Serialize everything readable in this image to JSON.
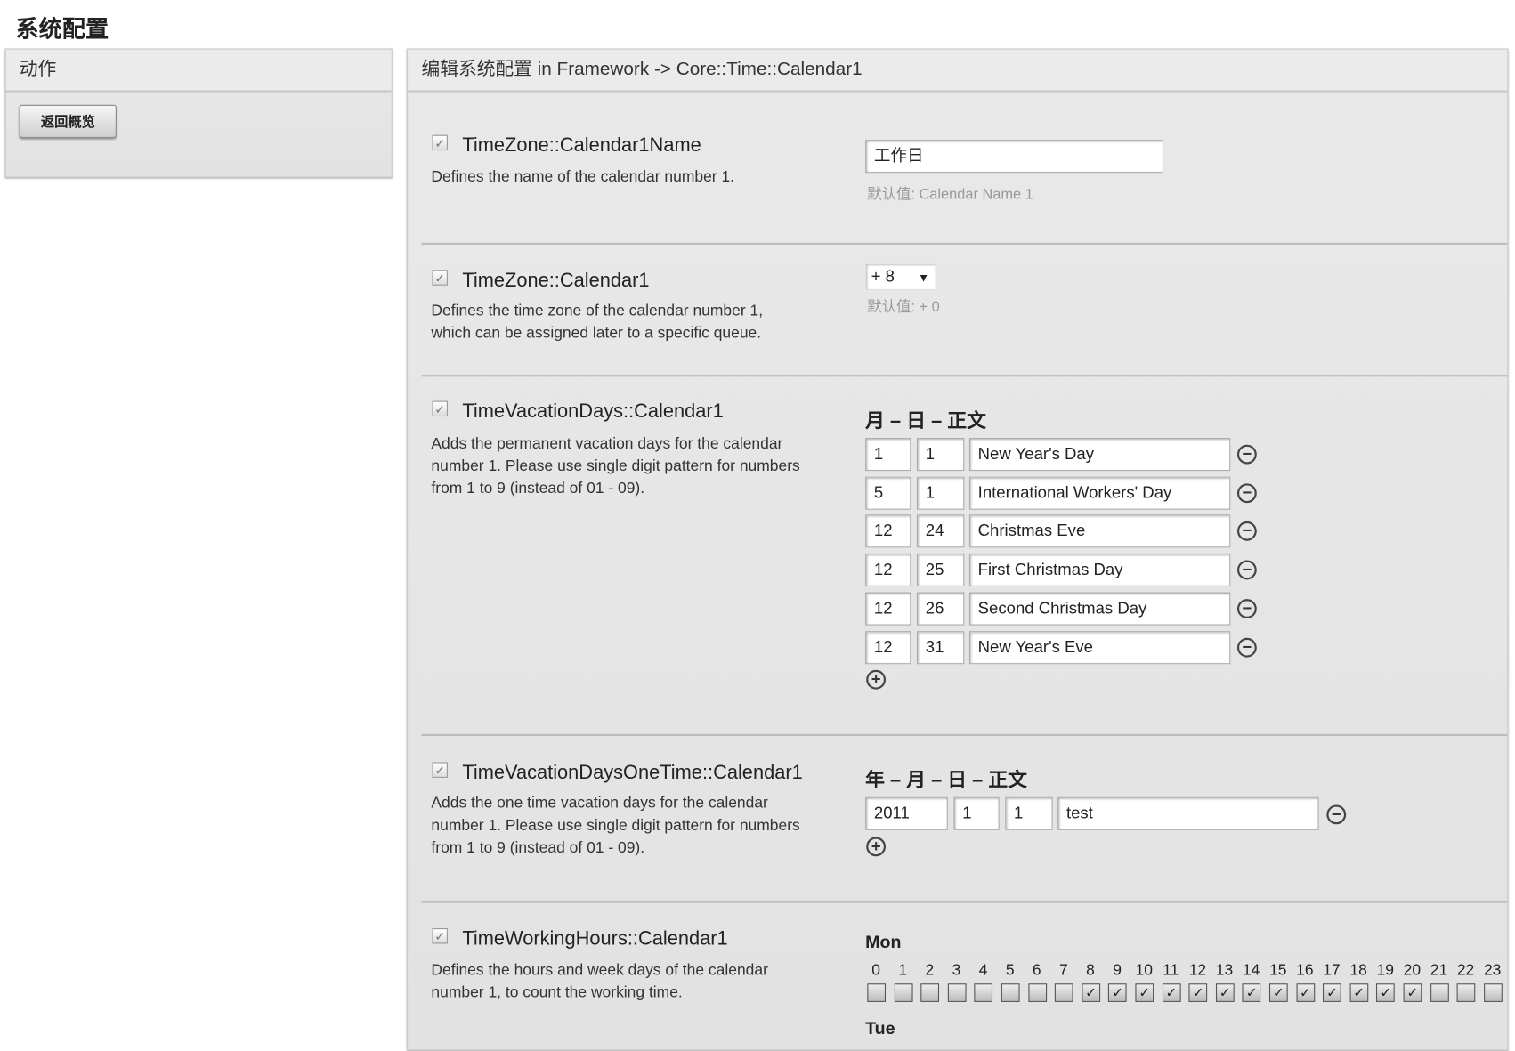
{
  "page_title": "系统配置",
  "actions": {
    "header": "动作",
    "back_button": "返回概览"
  },
  "main": {
    "header": "编辑系统配置 in Framework -> Core::Time::Calendar1"
  },
  "settings": [
    {
      "name": "TimeZone::Calendar1Name",
      "enabled": true,
      "description": [
        "Defines the name of the calendar number 1."
      ],
      "value": "工作日",
      "default": "默认值: Calendar Name 1"
    },
    {
      "name": "TimeZone::Calendar1",
      "enabled": true,
      "description": [
        "Defines the time zone of the calendar number 1,",
        "which can be assigned later to a specific queue."
      ],
      "value": "+ 8",
      "default": "默认值: + 0"
    },
    {
      "name": "TimeVacationDays::Calendar1",
      "enabled": true,
      "description": [
        "Adds the permanent vacation days for the calendar",
        "number 1. Please use single digit pattern for numbers",
        "from 1 to 9 (instead of 01 - 09)."
      ],
      "column_header": "月 – 日 – 正文",
      "rows": [
        [
          "1",
          "1",
          "New Year's Day"
        ],
        [
          "5",
          "1",
          "International Workers' Day"
        ],
        [
          "12",
          "24",
          "Christmas Eve"
        ],
        [
          "12",
          "25",
          "First Christmas Day"
        ],
        [
          "12",
          "26",
          "Second Christmas Day"
        ],
        [
          "12",
          "31",
          "New Year's Eve"
        ]
      ]
    },
    {
      "name": "TimeVacationDaysOneTime::Calendar1",
      "enabled": true,
      "description": [
        "Adds the one time vacation days for the calendar",
        "number 1. Please use single digit pattern for numbers",
        "from 1 to 9 (instead of 01 - 09)."
      ],
      "column_header": "年 – 月 – 日 – 正文",
      "rows": [
        [
          "2011",
          "1",
          "1",
          "test"
        ]
      ]
    },
    {
      "name": "TimeWorkingHours::Calendar1",
      "enabled": true,
      "description": [
        "Defines the hours and week days of the calendar",
        "number 1, to count the working time."
      ],
      "days": [
        {
          "day": "Mon",
          "checked_hours": [
            8,
            9,
            10,
            11,
            12,
            13,
            14,
            15,
            16,
            17,
            18,
            19,
            20
          ]
        },
        {
          "day": "Tue"
        }
      ],
      "hours": [
        "0",
        "1",
        "2",
        "3",
        "4",
        "5",
        "6",
        "7",
        "8",
        "9",
        "10",
        "11",
        "12",
        "13",
        "14",
        "15",
        "16",
        "17",
        "18",
        "19",
        "20",
        "21",
        "22",
        "23"
      ]
    }
  ],
  "icons": {
    "remove": "minus-circle-icon",
    "add": "plus-circle-icon",
    "check": "checkmark-icon"
  }
}
